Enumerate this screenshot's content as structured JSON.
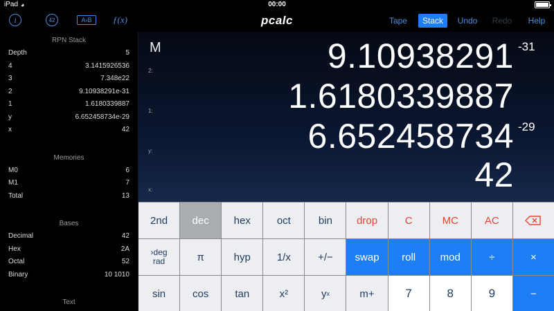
{
  "status_bar": {
    "device": "iPad",
    "time": "00:00"
  },
  "toolbar": {
    "info_icon_label": "i",
    "answer_icon_label": "42",
    "convert_icon_label": "A›B",
    "function_icon_label": "ƒ(x)",
    "app_title": "pcalc",
    "tape": "Tape",
    "stack": "Stack",
    "undo": "Undo",
    "redo": "Redo",
    "help": "Help"
  },
  "sidebar": {
    "rpn_title": "RPN Stack",
    "rpn": [
      {
        "label": "Depth",
        "value": "5"
      },
      {
        "label": "4",
        "value": "3.1415926536"
      },
      {
        "label": "3",
        "value": "7.348e22"
      },
      {
        "label": "2",
        "value": "9.10938291e-31"
      },
      {
        "label": "1",
        "value": "1.6180339887"
      },
      {
        "label": "y",
        "value": "6.652458734e-29"
      },
      {
        "label": "x",
        "value": "42"
      }
    ],
    "memories_title": "Memories",
    "memories": [
      {
        "label": "M0",
        "value": "6"
      },
      {
        "label": "M1",
        "value": "7"
      },
      {
        "label": "Total",
        "value": "13"
      }
    ],
    "bases_title": "Bases",
    "bases": [
      {
        "label": "Decimal",
        "value": "42"
      },
      {
        "label": "Hex",
        "value": "2A"
      },
      {
        "label": "Octal",
        "value": "52"
      },
      {
        "label": "Binary",
        "value": "10 1010"
      }
    ],
    "text_title": "Text"
  },
  "display": {
    "mode": "M",
    "labels": {
      "two": "2:",
      "one": "1:",
      "y": "y:",
      "x": "x:"
    },
    "stack2_mantissa": "9.10938291",
    "stack2_exponent": "-31",
    "stack1": "1.6180339887",
    "y_mantissa": "6.652458734",
    "y_exponent": "-29",
    "x": "42"
  },
  "keys": {
    "r1": [
      "2nd",
      "dec",
      "hex",
      "oct",
      "bin",
      "drop",
      "C",
      "MC",
      "AC"
    ],
    "deg_top": "›deg",
    "deg_bottom": "rad",
    "r2": [
      "π",
      "hyp",
      "1/x",
      "+/−",
      "swap",
      "roll",
      "mod",
      "÷",
      "×"
    ],
    "r3": [
      "sin",
      "cos",
      "tan",
      "x²",
      "y",
      "m+",
      "7",
      "8",
      "9",
      "−"
    ],
    "y_sup": "x"
  },
  "colors": {
    "accent": "#1e7ef5",
    "red_key": "#e8432e",
    "key_bg": "#eceef2"
  }
}
